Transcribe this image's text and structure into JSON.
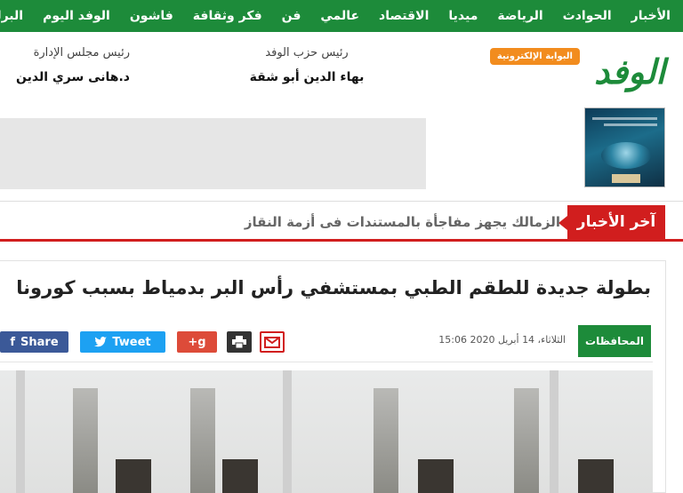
{
  "nav": {
    "items": [
      "الأخبار",
      "الحوادث",
      "الرياضة",
      "ميديا",
      "الاقتصاد",
      "عالمي",
      "فن",
      "فكر وثقافة",
      "فاشون",
      "الوفد اليوم",
      "البرلمان"
    ]
  },
  "logo": {
    "word": "الوفد",
    "badge": "البوابة الإلكترونية"
  },
  "staff": [
    {
      "role": "رئيس حزب الوفد",
      "name": "بهاء الدين أبو شقة"
    },
    {
      "role": "رئيس مجلس الإدارة",
      "name": "د.هانى سري الدين"
    }
  ],
  "ticker": {
    "label": "آخر الأخبار",
    "headline": "الزمالك يجهز مفاجأة بالمستندات فى أزمة النقاز"
  },
  "article": {
    "headline": "بطولة جديدة للطقم الطبي بمستشفي رأس البر بدمياط بسبب كورونا",
    "section": "المحافظات",
    "date": "الثلاثاء، 14 أبريل 2020 15:06",
    "share_label": "Share",
    "tweet_label": "Tweet",
    "gplus_label": "g+"
  },
  "colors": {
    "brand_green": "#1d8b3a",
    "accent_red": "#d11e1e",
    "logo_orange": "#f28c1e",
    "facebook": "#3b5998",
    "twitter": "#1da1f2",
    "gplus": "#dd4b39"
  },
  "icons": {
    "mail": "mail-icon",
    "print": "print-icon",
    "gplus": "google-plus-icon",
    "twitter": "twitter-bird-icon",
    "facebook": "facebook-icon"
  }
}
